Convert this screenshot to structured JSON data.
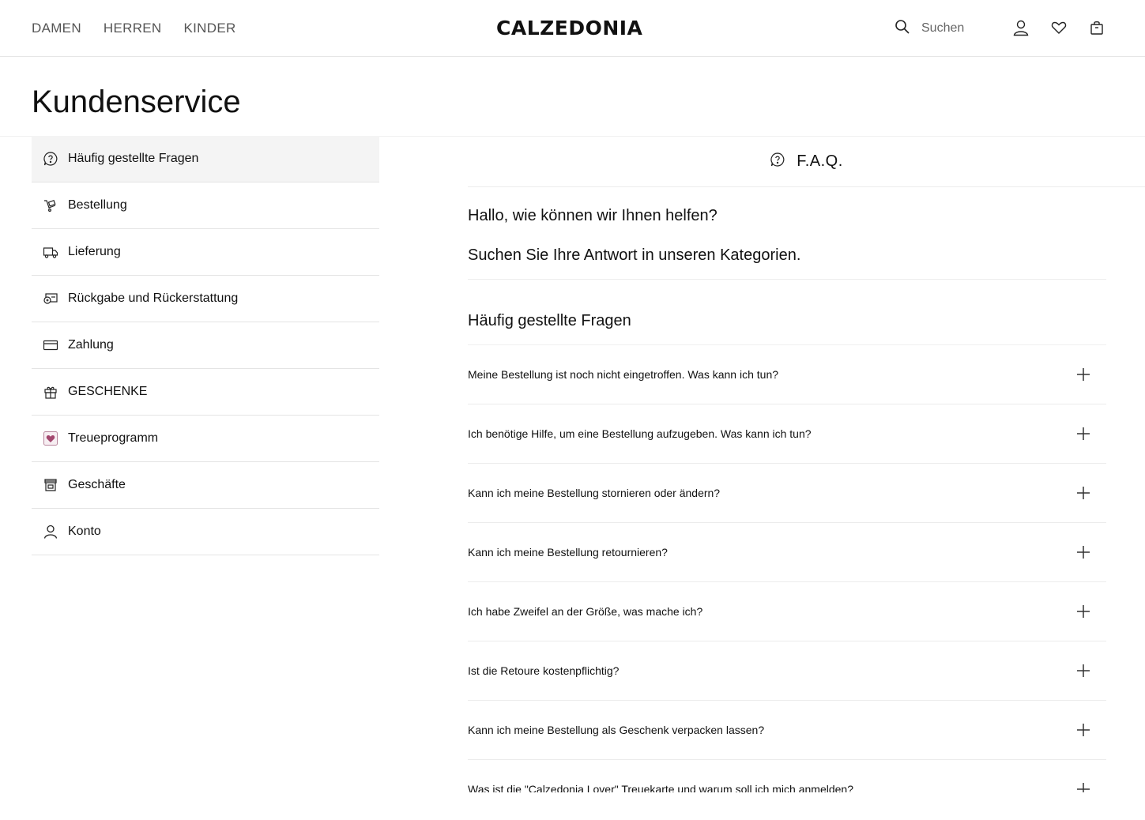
{
  "header": {
    "nav": [
      "DAMEN",
      "HERREN",
      "KINDER"
    ],
    "logo": "CALZEDONIA",
    "search_label": "Suchen",
    "icons": [
      "search-icon",
      "account-icon",
      "wishlist-heart-icon",
      "bag-icon"
    ]
  },
  "page": {
    "title": "Kundenservice"
  },
  "sidebar": {
    "items": [
      {
        "label": "Häufig gestellte Fragen",
        "icon": "question-bubble-icon",
        "active": true
      },
      {
        "label": "Bestellung",
        "icon": "order-cart-icon"
      },
      {
        "label": "Lieferung",
        "icon": "delivery-truck-icon"
      },
      {
        "label": "Rückgabe und Rückerstattung",
        "icon": "return-refund-icon"
      },
      {
        "label": "Zahlung",
        "icon": "credit-card-icon"
      },
      {
        "label": "GESCHENKE",
        "icon": "gift-icon"
      },
      {
        "label": "Treueprogramm",
        "icon": "loyalty-heart-icon",
        "accent": "#a3476e"
      },
      {
        "label": "Geschäfte",
        "icon": "store-icon"
      },
      {
        "label": "Konto",
        "icon": "user-icon"
      }
    ]
  },
  "main": {
    "faq_header": "F.A.Q.",
    "help_line1": "Hallo, wie können wir Ihnen helfen?",
    "help_line2": "Suchen Sie Ihre Antwort in unseren Kategorien.",
    "section_title": "Häufig gestellte Fragen",
    "questions": [
      "Meine Bestellung ist noch nicht eingetroffen. Was kann ich tun?",
      "Ich benötige Hilfe, um eine Bestellung aufzugeben. Was kann ich tun?",
      "Kann ich meine Bestellung stornieren oder ändern?",
      "Kann ich meine Bestellung retournieren?",
      "Ich habe Zweifel an der Größe, was mache ich?",
      "Ist die Retoure kostenpflichtig?",
      "Kann ich meine Bestellung als Geschenk verpacken lassen?",
      "Was ist die \"Calzedonia Lover\" Treuekarte und warum soll ich mich anmelden?"
    ]
  }
}
